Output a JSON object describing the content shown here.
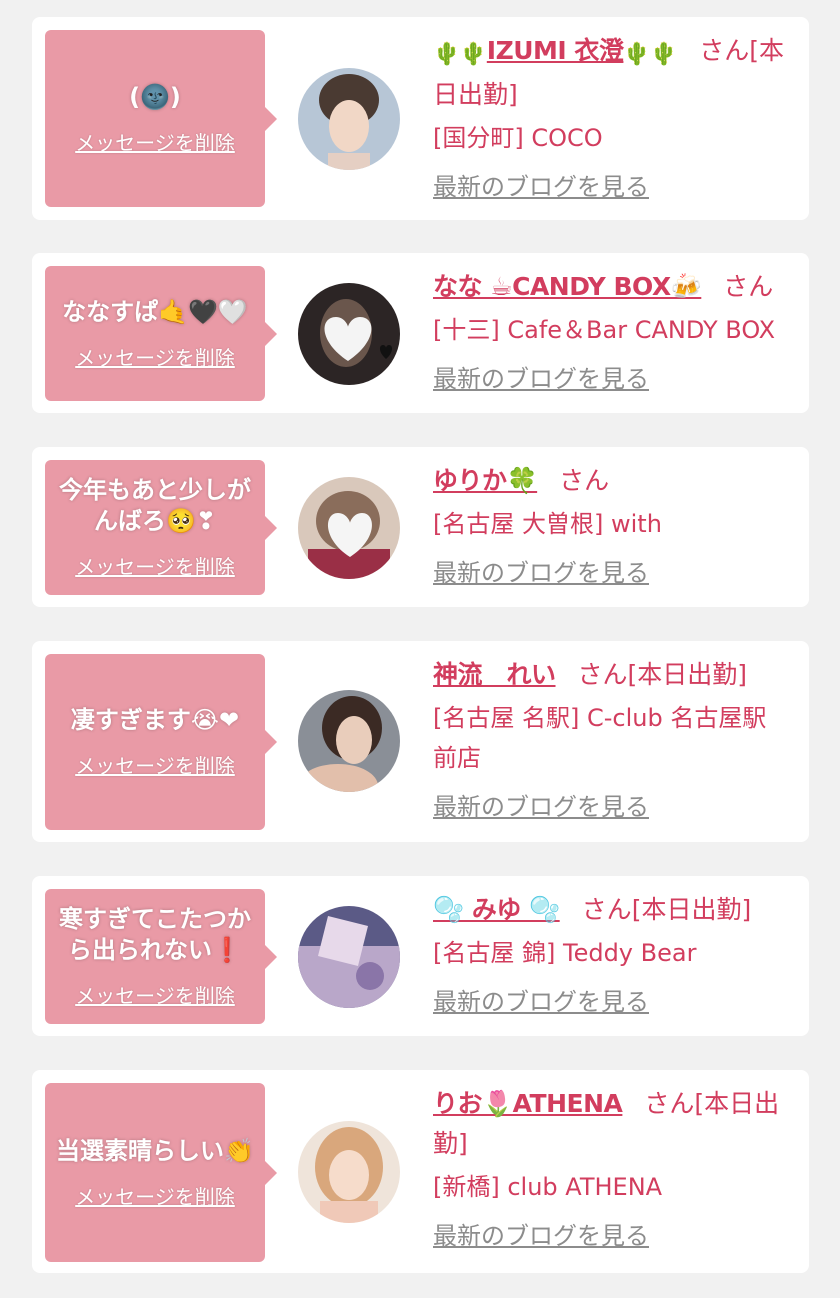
{
  "cards": [
    {
      "message": "(🌚)",
      "delete_label": "メッセージを削除",
      "name": "IZUMI 衣澄",
      "name_prefix_emoji": "🌵🌵",
      "name_mid_emoji": "🌵",
      "name_suffix_emoji": "🌵🌵",
      "san": "さん",
      "status": "[本日出勤]",
      "shop": "[国分町] COCO",
      "blog": "最新のブログを見る"
    },
    {
      "message": "ななすぱ🤙🖤🤍",
      "delete_label": "メッセージを削除",
      "name": "なな ☕CANDY BOX🍻",
      "san": "さん",
      "status": "",
      "shop": "[十三] Cafe＆Bar CANDY BOX",
      "blog": "最新のブログを見る"
    },
    {
      "message": "今年もあと少しがんばろ🥺❣",
      "delete_label": "メッセージを削除",
      "name": "ゆりか🍀",
      "san": "さん",
      "status": "",
      "shop": "[名古屋 大曽根] with",
      "blog": "最新のブログを見る"
    },
    {
      "message": "凄すぎます😭❤",
      "delete_label": "メッセージを削除",
      "name": "神流　れい",
      "san": "さん",
      "status": "[本日出勤]",
      "shop": "[名古屋 名駅] C-club 名古屋駅前店",
      "blog": "最新のブログを見る"
    },
    {
      "message": "寒すぎてこたつから出られない❗",
      "delete_label": "メッセージを削除",
      "name": "🫧 みゆ 🫧",
      "san": "さん",
      "status": "[本日出勤]",
      "shop": "[名古屋 錦] Teddy Bear",
      "blog": "最新のブログを見る"
    },
    {
      "message": "当選素晴らしい👏",
      "delete_label": "メッセージを削除",
      "name": "りお🌷ATHENA",
      "san": "さん",
      "status": "[本日出勤]",
      "shop": "[新橋] club ATHENA",
      "blog": "最新のブログを見る"
    }
  ],
  "colors": {
    "bubble": "#e99aa6",
    "name": "#d23d5e",
    "blog_link": "#8c8c8c",
    "background": "#f1f1f1"
  }
}
